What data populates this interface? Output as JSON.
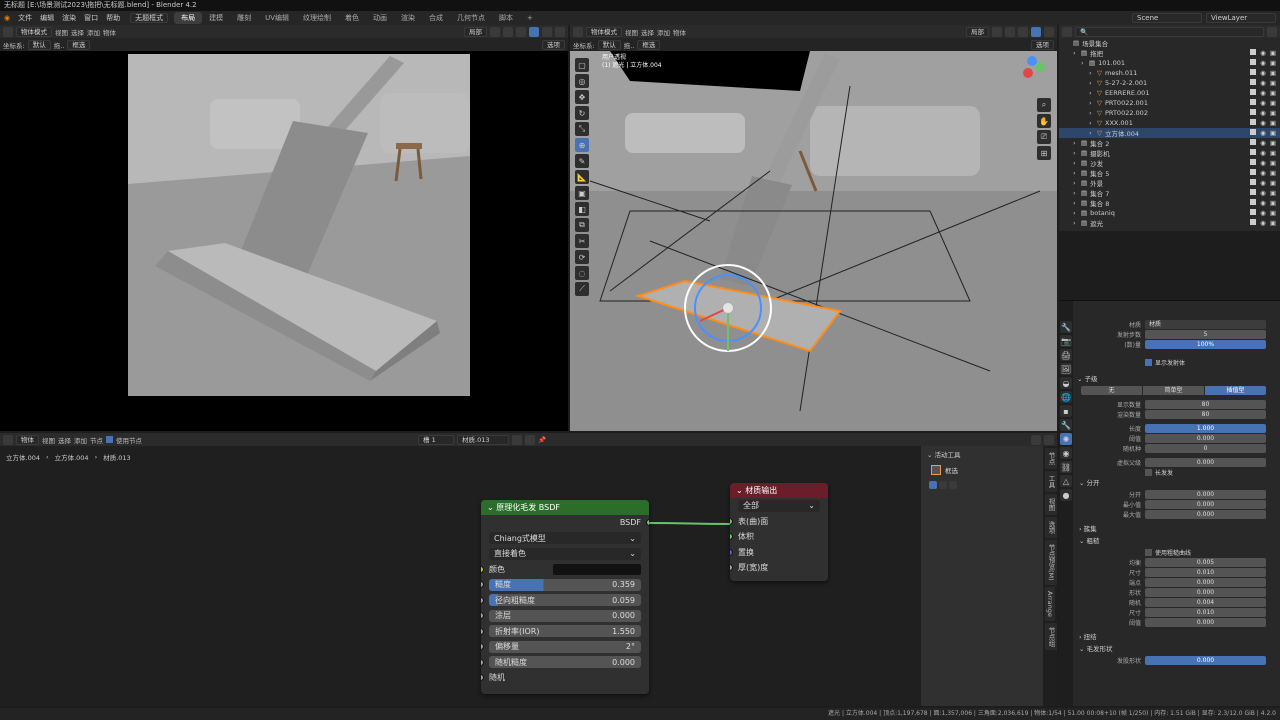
{
  "title_bar": "无标题 [E:\\场景测试2023\\拖把\\无标题.blend] - Blender 4.2",
  "menu": [
    "文件",
    "编辑",
    "渲染",
    "窗口",
    "帮助"
  ],
  "workspace_dropdown": "无题框式",
  "workspaces": [
    "布局",
    "建模",
    "雕刻",
    "UV编辑",
    "纹理绘制",
    "着色",
    "动画",
    "渲染",
    "合成",
    "几何节点",
    "脚本"
  ],
  "top_right": {
    "scene": "Scene",
    "view_layer": "ViewLayer"
  },
  "left_view": {
    "mode": "物体模式",
    "menus": [
      "视图",
      "选择",
      "添加",
      "物体"
    ],
    "transform": "局部",
    "orient_label": "坐标系:",
    "orient": "默认",
    "drag": "拖..",
    "select": "框选",
    "options": "选项"
  },
  "right_view": {
    "mode": "物体模式",
    "menus": [
      "视图",
      "选择",
      "添加",
      "物体"
    ],
    "transform": "局部",
    "orient_label": "坐标系:",
    "orient": "默认",
    "drag": "拖..",
    "select": "框选",
    "options": "选项",
    "overlay_text_1": "用户透视",
    "overlay_text_2": "(1) 遮光 | 立方体.004"
  },
  "outliner": {
    "root": "场景集合",
    "items": [
      {
        "label": "拖把",
        "indent": 1
      },
      {
        "label": "101.001",
        "indent": 2
      },
      {
        "label": "mesh.011",
        "indent": 3
      },
      {
        "label": "5-27-2-2.001",
        "indent": 3
      },
      {
        "label": "EERRERE.001",
        "indent": 3
      },
      {
        "label": "PRT0022.001",
        "indent": 3
      },
      {
        "label": "PRT0022.002",
        "indent": 3
      },
      {
        "label": "XXX.001",
        "indent": 3
      },
      {
        "label": "立方体.004",
        "indent": 3,
        "selected": true
      },
      {
        "label": "集合 2",
        "indent": 1
      },
      {
        "label": "摄影机",
        "indent": 1
      },
      {
        "label": "沙发",
        "indent": 1
      },
      {
        "label": "集合 5",
        "indent": 1
      },
      {
        "label": "外景",
        "indent": 1
      },
      {
        "label": "集合 7",
        "indent": 1
      },
      {
        "label": "集合 8",
        "indent": 1
      },
      {
        "label": "botaniq",
        "indent": 1
      },
      {
        "label": "遮光",
        "indent": 1
      }
    ]
  },
  "properties": {
    "material_label": "材质",
    "material_value": "材质",
    "steps_label": "发射步数",
    "steps_value": "5",
    "amount_label": "(数)量",
    "amount_value": "100%",
    "show_emitter": "显示发射体",
    "children_title": "子级",
    "children_tabs": [
      "无",
      "简单型",
      "插值型"
    ],
    "display_amount_label": "显示数量",
    "display_amount": "80",
    "render_amount_label": "渲染数量",
    "render_amount": "80",
    "length_label": "长度",
    "length": "1.000",
    "threshold_label": "阈值",
    "threshold": "0.000",
    "seed_label": "随机种",
    "seed": "0",
    "virtual_parents_label": "虚拟父级",
    "virtual_parents": "0.000",
    "long_hair": "长发发",
    "parting_title": "分开",
    "parting_label": "分开",
    "parting": "0.000",
    "min_label": "最小值",
    "min": "0.000",
    "max_label": "最大值",
    "max": "0.000",
    "clumping_title": "簇集",
    "roughness_title": "粗糙",
    "use_curve": "使用粗糙曲线",
    "rough_rows": [
      {
        "label": "均衡",
        "value": "0.005"
      },
      {
        "label": "尺寸",
        "value": "0.010"
      },
      {
        "label": "端点",
        "value": "0.000"
      },
      {
        "label": "形状",
        "value": "0.000"
      },
      {
        "label": "随机",
        "value": "0.004"
      },
      {
        "label": "尺寸",
        "value": "0.010"
      },
      {
        "label": "阈值",
        "value": "0.000"
      }
    ],
    "kink_title": "扭结",
    "hair_shape_title": "毛发形状",
    "hair_shape_label": "发股形状",
    "hair_shape_value": "0.000"
  },
  "node_editor": {
    "type": "物体",
    "menus": [
      "视图",
      "选择",
      "添加",
      "节点"
    ],
    "use_nodes": "使用节点",
    "slot": "槽 1",
    "material": "材质.013",
    "breadcrumb": [
      "立方体.004",
      "立方体.004",
      "材质.013"
    ],
    "sidebar_title": "活动工具",
    "sidebar_tool": "框选",
    "side_tabs": [
      "节点",
      "工具",
      "视图",
      "选项",
      "节点预览(M)",
      "Arrange",
      "节点组"
    ]
  },
  "bsdf_node": {
    "title": "原理化毛发 BSDF",
    "output": "BSDF",
    "model": "Chiang式模型",
    "parametrization": "直接着色",
    "color_label": "颜色",
    "fields": [
      {
        "label": "糙度",
        "value": "0.359",
        "fill": 0.359
      },
      {
        "label": "径向粗糙度",
        "value": "0.059",
        "fill": 0.059
      },
      {
        "label": "涂层",
        "value": "0.000",
        "fill": 0
      },
      {
        "label": "折射率(IOR)",
        "value": "1.550",
        "fill": 0
      },
      {
        "label": "偏移量",
        "value": "2°",
        "fill": 0
      },
      {
        "label": "随机糙度",
        "value": "0.000",
        "fill": 0
      }
    ],
    "random_label": "随机"
  },
  "output_node": {
    "title": "材质输出",
    "target": "全部",
    "sockets": [
      "表(曲)面",
      "体积",
      "置换",
      "厚(宽)度"
    ]
  },
  "status_bar": "遮光 | 立方体.004 | 顶点:1,197,678 | 面:1,357,006 | 三角面:2,036,619 | 物体:1/54 | 51.00 00:08+10 (帧 1/250) | 内存: 1.51 GiB | 显存: 2.3/12.0 GiB | 4.2.0",
  "colors": {
    "accent": "#4772b3",
    "bsdf_header": "#2a6e2a",
    "output_header": "#6b1e2a",
    "select": "#ff8c1a"
  }
}
